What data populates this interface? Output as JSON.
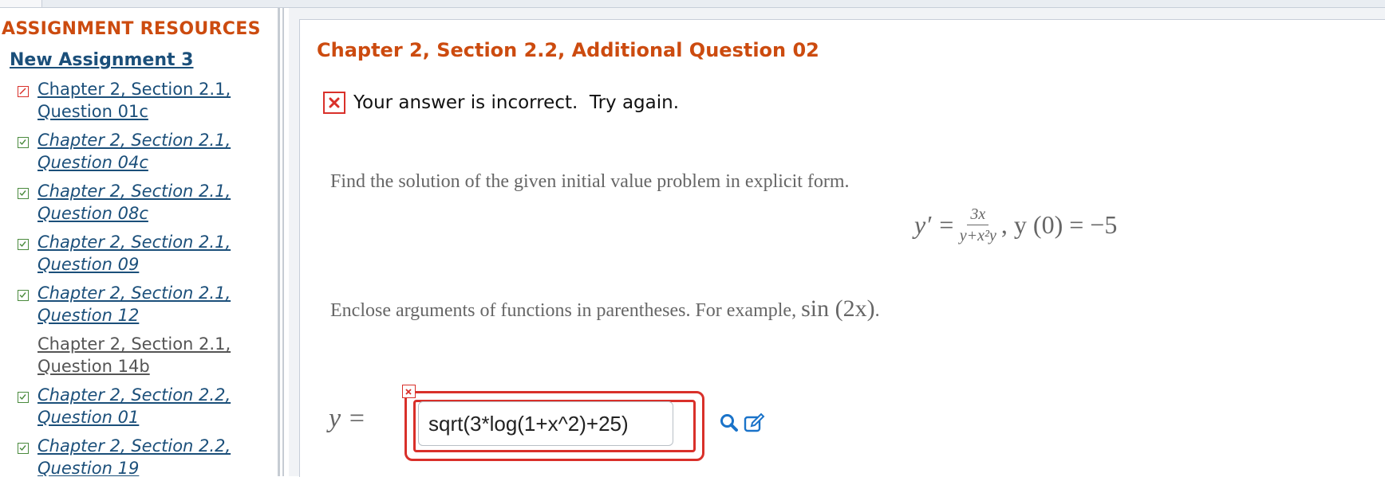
{
  "sidebar": {
    "heading": "ASSIGNMENT RESOURCES",
    "assignment": "New Assignment 3",
    "items": [
      {
        "line1": "Chapter 2, Section 2.1,",
        "line2": "Question 01c",
        "status": "pencil-icon"
      },
      {
        "line1": "Chapter 2, Section 2.1,",
        "line2": "Question 04c",
        "status": "check-icon"
      },
      {
        "line1": "Chapter 2, Section 2.1,",
        "line2": "Question 08c",
        "status": "check-icon"
      },
      {
        "line1": "Chapter 2, Section 2.1,",
        "line2": "Question 09",
        "status": "check-icon"
      },
      {
        "line1": "Chapter 2, Section 2.1,",
        "line2": "Question 12",
        "status": "check-icon"
      },
      {
        "line1": "Chapter 2, Section 2.1,",
        "line2": "Question 14b",
        "status": "none"
      },
      {
        "line1": "Chapter 2, Section 2.2,",
        "line2": "Question 01",
        "status": "check-icon"
      },
      {
        "line1": "Chapter 2, Section 2.2,",
        "line2": "Question 19",
        "status": "check-icon"
      }
    ]
  },
  "main": {
    "title": "Chapter 2, Section 2.2, Additional Question 02",
    "feedback": "Your answer is incorrect.  Try again.",
    "instruction": "Find the solution of the given initial value problem in explicit form.",
    "equation": {
      "lhs": "y′ =",
      "numerator": "3x",
      "denominator": "y+x²y",
      "rhs": ",  y (0) = −5"
    },
    "enclose_text": "Enclose arguments of functions in parentheses. For example, ",
    "enclose_example": "sin (2x)",
    "enclose_end": ".",
    "answer_label": "y =",
    "answer_value": "sqrt(3*log(1+x^2)+25)"
  },
  "colors": {
    "accent_orange": "#cc4b0f",
    "link_blue": "#1b4f7a",
    "error_red": "#d9302a",
    "check_green": "#4a8a3d",
    "tool_blue": "#1a73c9"
  }
}
